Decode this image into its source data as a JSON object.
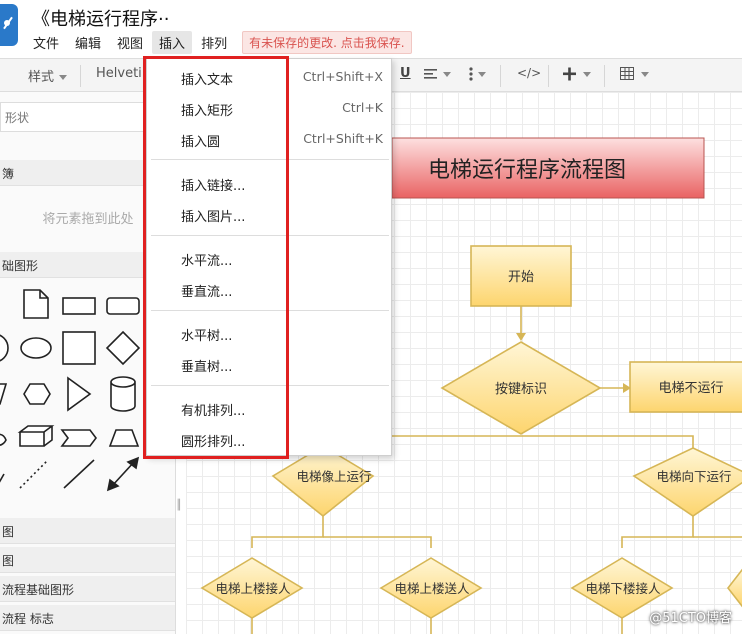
{
  "window": {
    "title": "《电梯运行程序··"
  },
  "menubar": {
    "items": [
      "文件",
      "编辑",
      "视图",
      "插入",
      "排列"
    ],
    "active_index": 3,
    "unsaved_notice": "有未保存的更改. 点击我保存."
  },
  "toolbar": {
    "style_label": "样式",
    "font_label": "Helveti",
    "underline_label": "U",
    "code_label": "</>"
  },
  "sidebar": {
    "search_placeholder": "形状",
    "sections": {
      "scratchpad": "簿",
      "drop_hint": "将元素拖到此处",
      "basic_shapes": "础图形",
      "list": [
        "图",
        "图",
        "流程基础图形",
        "流程 标志"
      ]
    }
  },
  "insert_menu": {
    "groups": [
      [
        {
          "label": "插入文本",
          "shortcut": "Ctrl+Shift+X"
        },
        {
          "label": "插入矩形",
          "shortcut": "Ctrl+K"
        },
        {
          "label": "插入圆",
          "shortcut": "Ctrl+Shift+K"
        }
      ],
      [
        {
          "label": "插入链接...",
          "shortcut": ""
        },
        {
          "label": "插入图片...",
          "shortcut": ""
        }
      ],
      [
        {
          "label": "水平流...",
          "shortcut": ""
        },
        {
          "label": "垂直流...",
          "shortcut": ""
        }
      ],
      [
        {
          "label": "水平树...",
          "shortcut": ""
        },
        {
          "label": "垂直树...",
          "shortcut": ""
        }
      ],
      [
        {
          "label": "有机排列...",
          "shortcut": ""
        },
        {
          "label": "圆形排列...",
          "shortcut": ""
        }
      ]
    ]
  },
  "diagram": {
    "title": "电梯运行程序流程图",
    "start": "开始",
    "decision": "按键标识",
    "not_running": "电梯不运行",
    "up": "电梯像上运行",
    "down": "电梯向下运行",
    "up_pickup": "电梯上楼接人",
    "up_dropoff": "电梯上楼送人",
    "down_pickup": "电梯下楼接人"
  },
  "watermark": "@51CTO博客",
  "colors": {
    "accent": "#2a79c9",
    "highlight_box": "#e02020",
    "node_fill": "#fde39a",
    "node_stroke": "#d6b656",
    "title_fill": "#f26d6d"
  }
}
